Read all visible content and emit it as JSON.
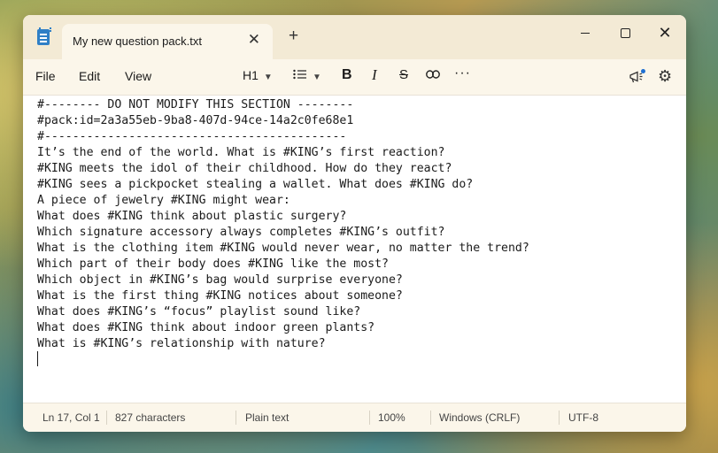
{
  "window": {
    "tab_title": "My new question pack.txt",
    "tab_close": "✕",
    "new_tab": "+"
  },
  "menu": {
    "file": "File",
    "edit": "Edit",
    "view": "View"
  },
  "toolbar": {
    "heading": "H1",
    "bold": "B",
    "italic": "I",
    "strike": "S",
    "link": "⛓",
    "more": "···"
  },
  "editor": {
    "lines": [
      "#-------- DO NOT MODIFY THIS SECTION --------",
      "#pack:id=2a3a55eb-9ba8-407d-94ce-14a2c0fe68e1",
      "#-------------------------------------------",
      "It’s the end of the world. What is #KING’s first reaction?",
      "#KING meets the idol of their childhood. How do they react?",
      "#KING sees a pickpocket stealing a wallet. What does #KING do?",
      "A piece of jewelry #KING might wear:",
      "What does #KING think about plastic surgery?",
      "Which signature accessory always completes #KING’s outfit?",
      "What is the clothing item #KING would never wear, no matter the trend?",
      "Which part of their body does #KING like the most?",
      "Which object in #KING’s bag would surprise everyone?",
      "What is the first thing #KING notices about someone?",
      "What does #KING’s “focus” playlist sound like?",
      "What does #KING think about indoor green plants?",
      "What is #KING’s relationship with nature?"
    ]
  },
  "status": {
    "position": "Ln 17, Col 1",
    "characters": "827 characters",
    "format": "Plain text",
    "zoom": "100%",
    "line_ending": "Windows (CRLF)",
    "encoding": "UTF-8"
  },
  "colors": {
    "titlebar": "#f3ead5",
    "accent": "#1f6fd1"
  }
}
